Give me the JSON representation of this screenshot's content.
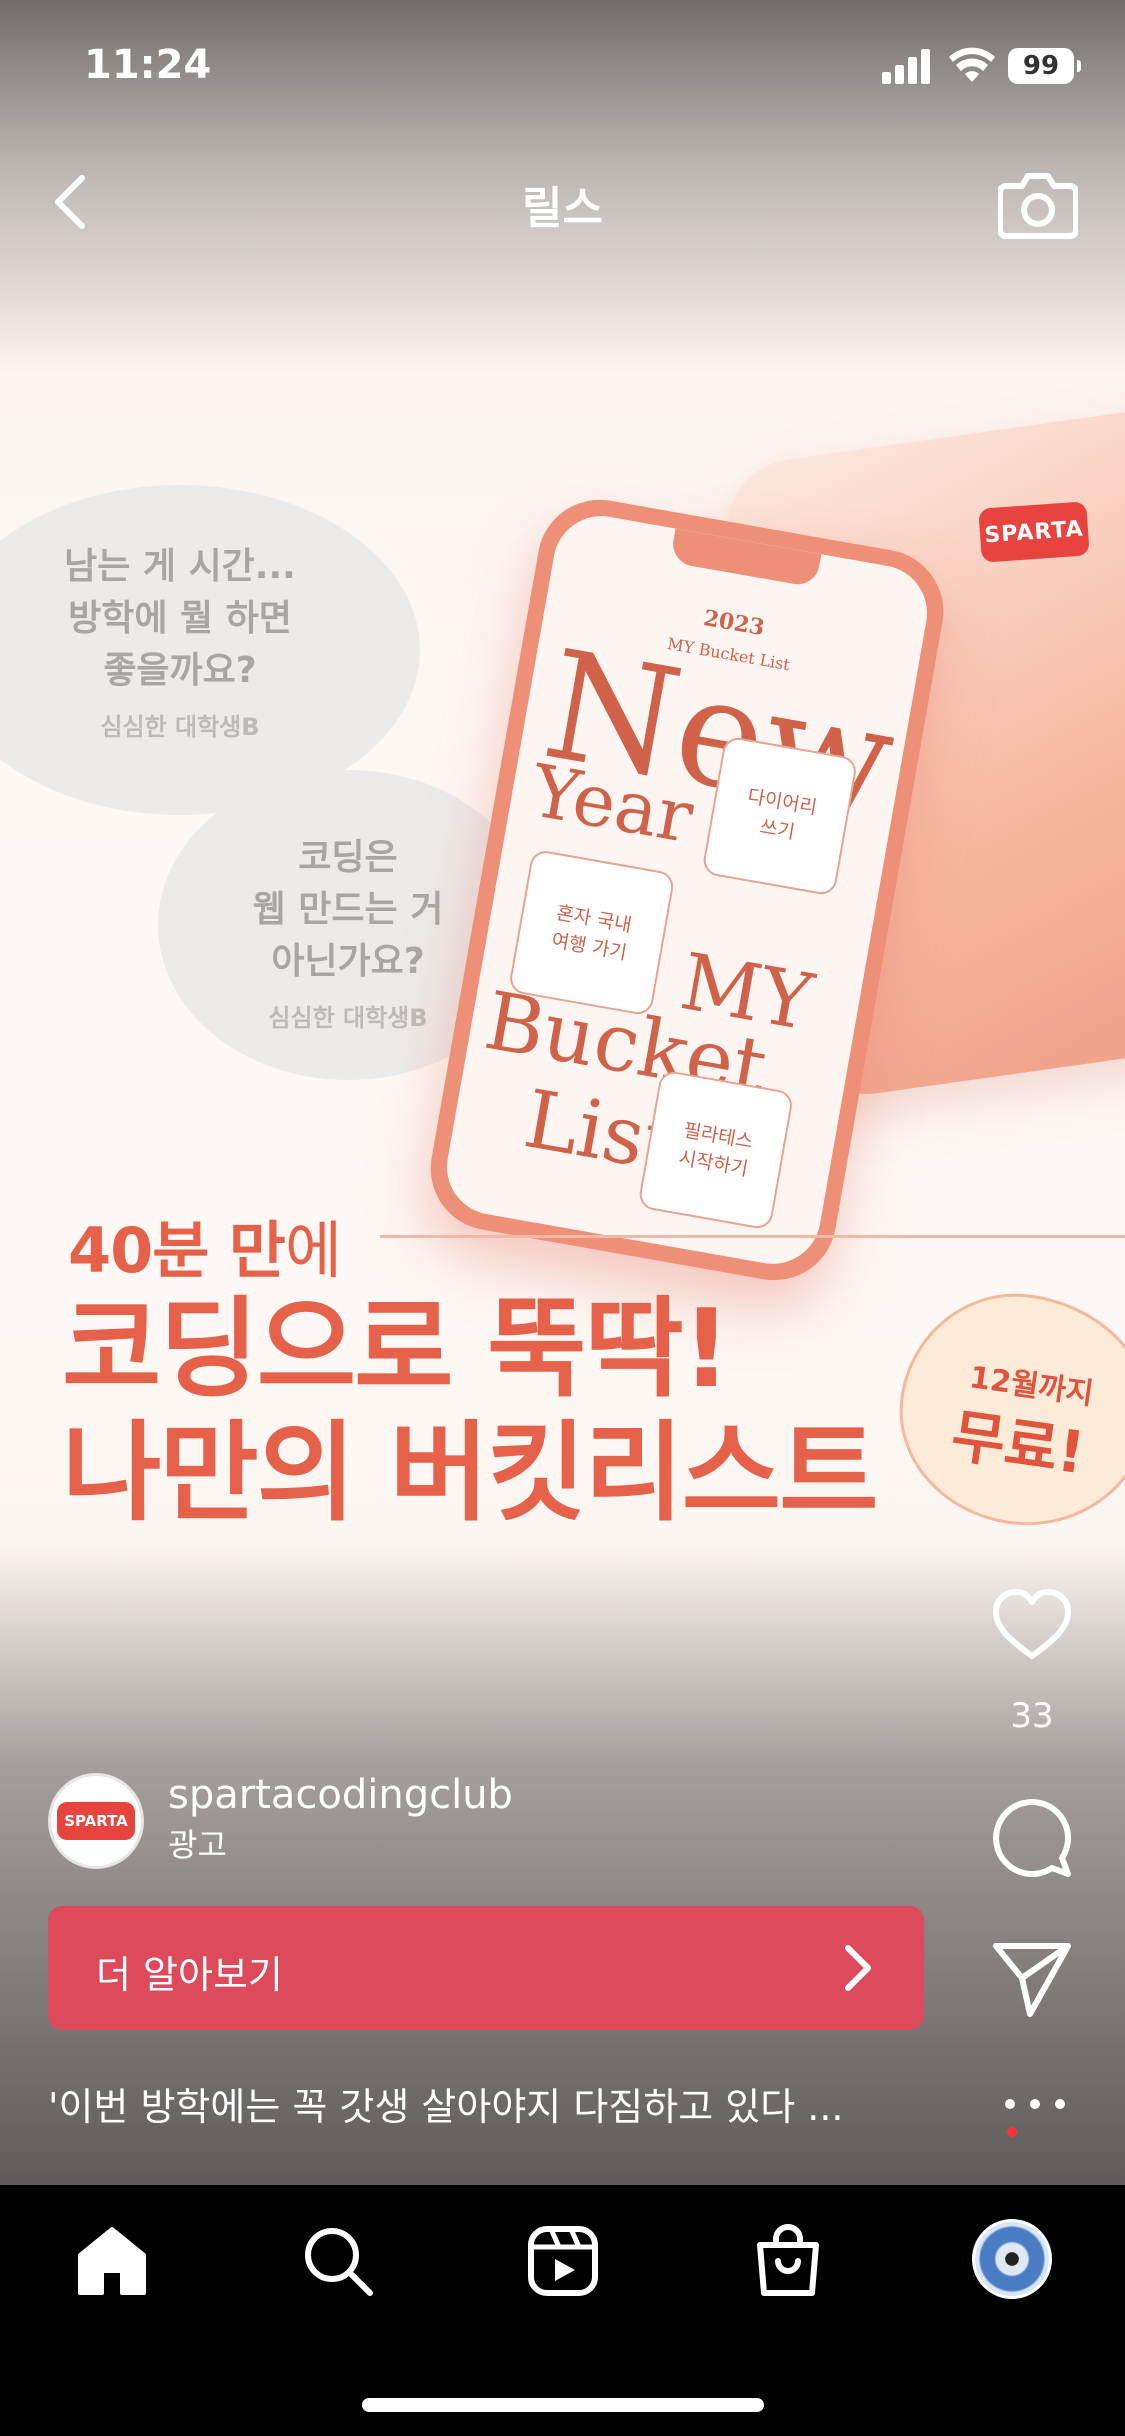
{
  "status_bar": {
    "time": "11:24",
    "battery": "99"
  },
  "nav": {
    "title": "릴스"
  },
  "ad": {
    "brand_badge": "SPARTA",
    "bubble1": {
      "question": "남는 게 시간...\n방학에 뭘 하면\n좋을까요?",
      "author": "심심한 대학생B"
    },
    "bubble2": {
      "question": "코딩은\n웹 만드는 거\n아닌가요?",
      "author": "심심한 대학생B"
    },
    "phone": {
      "year": "2023",
      "subtitle": "MY Bucket List",
      "word_new": "New",
      "word_year": "Year",
      "word_my": "MY",
      "word_bucket": "Bucket",
      "word_list": "List",
      "card1": "다이어리\n쓰기",
      "card2": "혼자 국내\n여행 가기",
      "card3": "필라테스\n시작하기"
    },
    "headline_small_bold": "40분 만",
    "headline_small_rest": "에",
    "headline_line1": "코딩으로 뚝딱!",
    "headline_line2": "나만의 버킷리스트",
    "seal_line1": "12월까지",
    "seal_line2": "무료!"
  },
  "actions": {
    "like_count": "33"
  },
  "account": {
    "avatar_label": "SPARTA",
    "name": "spartacodingclub",
    "sponsored": "광고"
  },
  "cta": {
    "label": "더 알아보기"
  },
  "caption": "'이번 방학에는 꼭 갓생 살아야지 다짐하고 있다 ...",
  "colors": {
    "accent": "#e6614a",
    "cta": "#dc4a5b",
    "tabbar": "#000000"
  },
  "tabs": [
    "home-icon",
    "search-icon",
    "reels-icon",
    "shop-icon",
    "profile-avatar"
  ]
}
